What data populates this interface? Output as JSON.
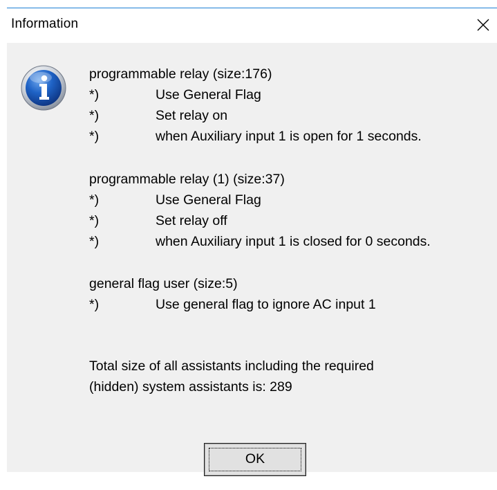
{
  "window": {
    "title": "Information",
    "close_glyph": "close-icon"
  },
  "icon": "info-icon",
  "sections": [
    {
      "heading": "programmable relay (size:176)",
      "items": [
        {
          "bullet": "*)",
          "text": "Use General Flag"
        },
        {
          "bullet": "*)",
          "text": "Set relay on"
        },
        {
          "bullet": "*)",
          "text": "when Auxiliary input 1 is open for 1 seconds."
        }
      ]
    },
    {
      "heading": "programmable relay (1) (size:37)",
      "items": [
        {
          "bullet": "*)",
          "text": "Use General Flag"
        },
        {
          "bullet": "*)",
          "text": "Set relay off"
        },
        {
          "bullet": "*)",
          "text": "when Auxiliary input 1 is closed for 0 seconds."
        }
      ]
    },
    {
      "heading": "general flag user (size:5)",
      "items": [
        {
          "bullet": "*)",
          "text": "Use general flag to ignore AC input 1"
        }
      ]
    }
  ],
  "summary": {
    "line1": "Total size of all assistants including the required",
    "line2": "(hidden) system assistants is: 289"
  },
  "buttons": {
    "ok_label": "OK"
  },
  "colors": {
    "title_border": "#1a7fd4",
    "client_bg": "#f0f0f0",
    "icon_blue": "#1d5fb8"
  }
}
